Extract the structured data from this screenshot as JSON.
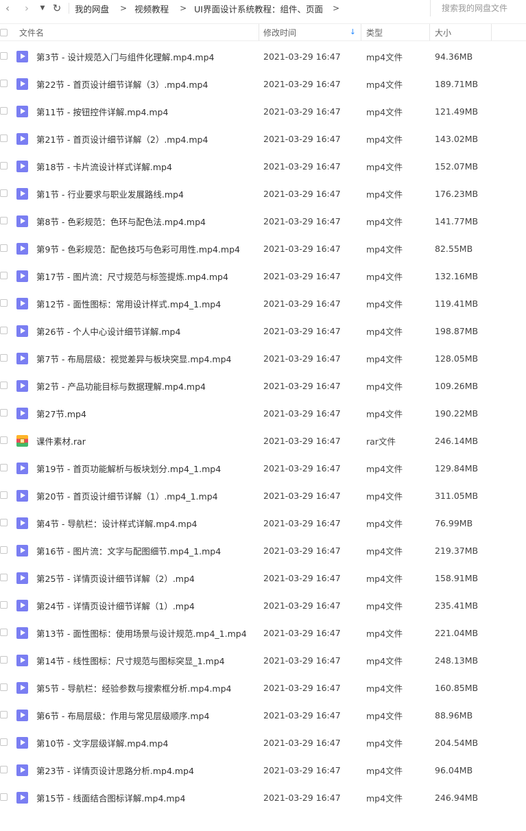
{
  "toolbar": {
    "back_glyph": "‹",
    "forward_glyph": "›",
    "dropdown_glyph": "▼",
    "refresh_glyph": "↻",
    "icons": [
      "chevron-left-icon",
      "chevron-right-icon",
      "caret-down-icon",
      "refresh-icon"
    ]
  },
  "breadcrumb": {
    "items": [
      "我的网盘",
      "视频教程",
      "UI界面设计系统教程：组件、页面"
    ],
    "separator": ">"
  },
  "search": {
    "placeholder": "搜索我的网盘文件"
  },
  "columns": {
    "name": "文件名",
    "modified": "修改时间",
    "type": "类型",
    "size": "大小",
    "sort_indicator": "↓"
  },
  "colors": {
    "video_icon": "#7a7ef2",
    "sort_arrow": "#2b8cff",
    "divider": "#eeeeee"
  },
  "files": [
    {
      "name": "第3节 - 设计规范入门与组件化理解.mp4.mp4",
      "modified": "2021-03-29 16:47",
      "type": "mp4文件",
      "size": "94.36MB",
      "icon": "video-file-icon"
    },
    {
      "name": "第22节 - 首页设计细节详解（3）.mp4.mp4",
      "modified": "2021-03-29 16:47",
      "type": "mp4文件",
      "size": "189.71MB",
      "icon": "video-file-icon"
    },
    {
      "name": "第11节 - 按钮控件详解.mp4.mp4",
      "modified": "2021-03-29 16:47",
      "type": "mp4文件",
      "size": "121.49MB",
      "icon": "video-file-icon"
    },
    {
      "name": "第21节 - 首页设计细节详解（2）.mp4.mp4",
      "modified": "2021-03-29 16:47",
      "type": "mp4文件",
      "size": "143.02MB",
      "icon": "video-file-icon"
    },
    {
      "name": "第18节 - 卡片流设计样式详解.mp4",
      "modified": "2021-03-29 16:47",
      "type": "mp4文件",
      "size": "152.07MB",
      "icon": "video-file-icon"
    },
    {
      "name": "第1节 - 行业要求与职业发展路线.mp4",
      "modified": "2021-03-29 16:47",
      "type": "mp4文件",
      "size": "176.23MB",
      "icon": "video-file-icon"
    },
    {
      "name": "第8节 - 色彩规范：色环与配色法.mp4.mp4",
      "modified": "2021-03-29 16:47",
      "type": "mp4文件",
      "size": "141.77MB",
      "icon": "video-file-icon"
    },
    {
      "name": "第9节 - 色彩规范：配色技巧与色彩可用性.mp4.mp4",
      "modified": "2021-03-29 16:47",
      "type": "mp4文件",
      "size": "82.55MB",
      "icon": "video-file-icon"
    },
    {
      "name": "第17节 - 图片流：尺寸规范与标签提炼.mp4.mp4",
      "modified": "2021-03-29 16:47",
      "type": "mp4文件",
      "size": "132.16MB",
      "icon": "video-file-icon"
    },
    {
      "name": "第12节 - 面性图标：常用设计样式.mp4_1.mp4",
      "modified": "2021-03-29 16:47",
      "type": "mp4文件",
      "size": "119.41MB",
      "icon": "video-file-icon"
    },
    {
      "name": "第26节 - 个人中心设计细节详解.mp4",
      "modified": "2021-03-29 16:47",
      "type": "mp4文件",
      "size": "198.87MB",
      "icon": "video-file-icon"
    },
    {
      "name": "第7节 - 布局层级：视觉差异与板块突显.mp4.mp4",
      "modified": "2021-03-29 16:47",
      "type": "mp4文件",
      "size": "128.05MB",
      "icon": "video-file-icon"
    },
    {
      "name": "第2节 - 产品功能目标与数据理解.mp4.mp4",
      "modified": "2021-03-29 16:47",
      "type": "mp4文件",
      "size": "109.26MB",
      "icon": "video-file-icon"
    },
    {
      "name": "第27节.mp4",
      "modified": "2021-03-29 16:47",
      "type": "mp4文件",
      "size": "190.22MB",
      "icon": "video-file-icon"
    },
    {
      "name": "课件素材.rar",
      "modified": "2021-03-29 16:47",
      "type": "rar文件",
      "size": "246.14MB",
      "icon": "archive-file-icon"
    },
    {
      "name": "第19节 - 首页功能解析与板块划分.mp4_1.mp4",
      "modified": "2021-03-29 16:47",
      "type": "mp4文件",
      "size": "129.84MB",
      "icon": "video-file-icon"
    },
    {
      "name": "第20节 - 首页设计细节详解（1）.mp4_1.mp4",
      "modified": "2021-03-29 16:47",
      "type": "mp4文件",
      "size": "311.05MB",
      "icon": "video-file-icon"
    },
    {
      "name": "第4节 - 导航栏：设计样式详解.mp4.mp4",
      "modified": "2021-03-29 16:47",
      "type": "mp4文件",
      "size": "76.99MB",
      "icon": "video-file-icon"
    },
    {
      "name": "第16节 - 图片流：文字与配图细节.mp4_1.mp4",
      "modified": "2021-03-29 16:47",
      "type": "mp4文件",
      "size": "219.37MB",
      "icon": "video-file-icon"
    },
    {
      "name": "第25节 - 详情页设计细节详解（2）.mp4",
      "modified": "2021-03-29 16:47",
      "type": "mp4文件",
      "size": "158.91MB",
      "icon": "video-file-icon"
    },
    {
      "name": "第24节 - 详情页设计细节详解（1）.mp4",
      "modified": "2021-03-29 16:47",
      "type": "mp4文件",
      "size": "235.41MB",
      "icon": "video-file-icon"
    },
    {
      "name": "第13节 - 面性图标：使用场景与设计规范.mp4_1.mp4",
      "modified": "2021-03-29 16:47",
      "type": "mp4文件",
      "size": "221.04MB",
      "icon": "video-file-icon"
    },
    {
      "name": "第14节 - 线性图标：尺寸规范与图标突显_1.mp4",
      "modified": "2021-03-29 16:47",
      "type": "mp4文件",
      "size": "248.13MB",
      "icon": "video-file-icon"
    },
    {
      "name": "第5节 - 导航栏：经验参数与搜索框分析.mp4.mp4",
      "modified": "2021-03-29 16:47",
      "type": "mp4文件",
      "size": "160.85MB",
      "icon": "video-file-icon"
    },
    {
      "name": "第6节 - 布局层级：作用与常见层级顺序.mp4",
      "modified": "2021-03-29 16:47",
      "type": "mp4文件",
      "size": "88.96MB",
      "icon": "video-file-icon"
    },
    {
      "name": "第10节 - 文字层级详解.mp4.mp4",
      "modified": "2021-03-29 16:47",
      "type": "mp4文件",
      "size": "204.54MB",
      "icon": "video-file-icon"
    },
    {
      "name": "第23节 - 详情页设计思路分析.mp4.mp4",
      "modified": "2021-03-29 16:47",
      "type": "mp4文件",
      "size": "96.04MB",
      "icon": "video-file-icon"
    },
    {
      "name": "第15节 - 线面结合图标详解.mp4.mp4",
      "modified": "2021-03-29 16:47",
      "type": "mp4文件",
      "size": "246.94MB",
      "icon": "video-file-icon"
    }
  ]
}
